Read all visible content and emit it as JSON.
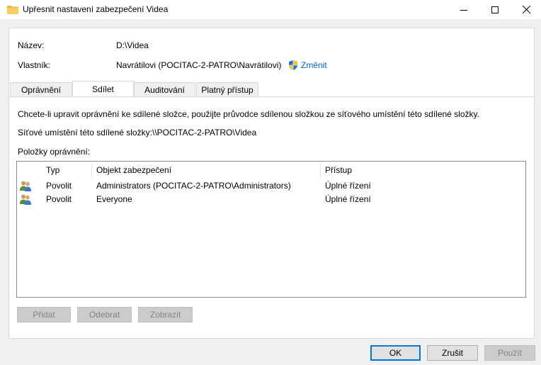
{
  "window": {
    "title": "Upřesnit nastavení zabezpečení Videa"
  },
  "fields": {
    "name_label": "Název:",
    "name_value": "D:\\Videa",
    "owner_label": "Vlastník:",
    "owner_value": "Navrátilovi (POCITAC-2-PATRO\\Navrátilovi)",
    "change_link": "Změnit"
  },
  "tabs": [
    {
      "label": "Oprávnění"
    },
    {
      "label": "Sdílet"
    },
    {
      "label": "Auditování"
    },
    {
      "label": "Platný přístup"
    }
  ],
  "share": {
    "instructions": "Chcete-li upravit oprávnění ke sdílené složce, použijte průvodce sdílenou složkou ze síťového umístění této sdílené složky.",
    "network_location_label": "Síťové umístění této sdílené složky:",
    "network_location_value": "\\\\POCITAC-2-PATRO\\Videa",
    "entries_label": "Položky oprávnění:"
  },
  "table": {
    "columns": [
      "Typ",
      "Objekt zabezpečení",
      "Přístup"
    ],
    "rows": [
      {
        "type": "Povolit",
        "principal": "Administrators (POCITAC-2-PATRO\\Administrators)",
        "access": "Úplné řízení"
      },
      {
        "type": "Povolit",
        "principal": "Everyone",
        "access": "Úplné řízení"
      }
    ]
  },
  "actions": {
    "add": "Přidat",
    "remove": "Odebrat",
    "view": "Zobrazit"
  },
  "footer": {
    "ok": "OK",
    "cancel": "Zrušit",
    "apply": "Použít"
  },
  "colors": {
    "accent": "#0078d7",
    "link": "#0066cc"
  }
}
